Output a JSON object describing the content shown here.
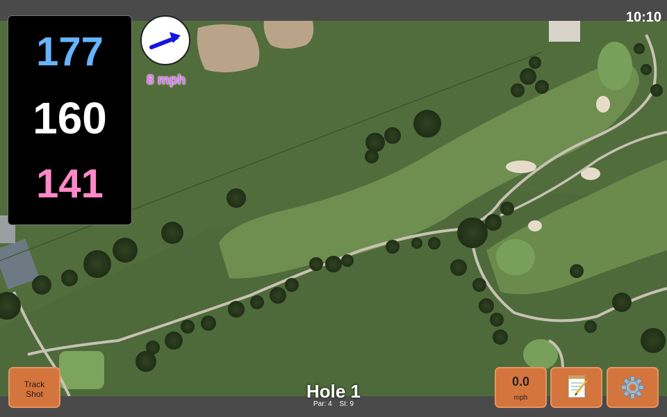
{
  "status": {
    "time": "10:10"
  },
  "yardages": {
    "back": "177",
    "middle": "160",
    "front": "141"
  },
  "wind": {
    "speed_label": "8 mph",
    "direction": "east-north-east"
  },
  "hole": {
    "title": "Hole 1",
    "par": "Par: 4",
    "stroke_index": "SI: 9"
  },
  "buttons": {
    "track_shot_line1": "Track",
    "track_shot_line2": "Shot",
    "speed_value": "0.0",
    "speed_unit": "mph",
    "notes_icon": "notepad-icon",
    "settings_icon": "gear-icon"
  },
  "colors": {
    "back_yardage": "#66b4ff",
    "middle_yardage": "#ffffff",
    "front_yardage": "#ff88c8",
    "wind_label": "#e070ff",
    "button": "#d4753e"
  }
}
